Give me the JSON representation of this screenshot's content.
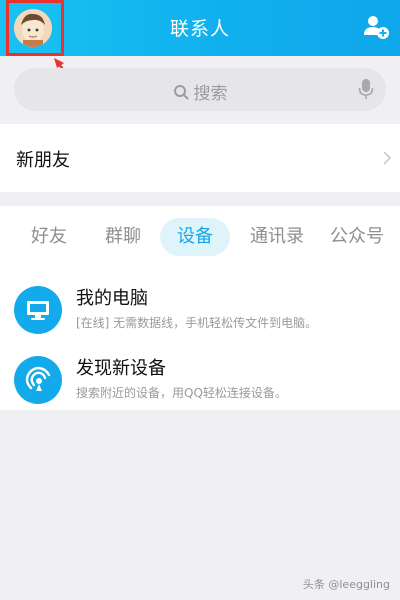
{
  "header": {
    "title": "联系人",
    "avatar_icon": "user-avatar-icon",
    "add_contact_icon": "add-contact-icon",
    "background_color": "#12b3ef"
  },
  "search": {
    "placeholder": "搜索",
    "search_icon": "search-icon",
    "mic_icon": "microphone-icon"
  },
  "new_friends": {
    "label": "新朋友",
    "chevron_icon": "chevron-right-icon"
  },
  "tabs": [
    {
      "label": "好友",
      "active": false
    },
    {
      "label": "群聊",
      "active": false
    },
    {
      "label": "设备",
      "active": true
    },
    {
      "label": "通讯录",
      "active": false
    },
    {
      "label": "公众号",
      "active": false
    }
  ],
  "devices": [
    {
      "title": "我的电脑",
      "subtitle": "[在线] 无需数据线，手机轻松传文件到电脑。",
      "icon": "computer-icon"
    },
    {
      "title": "发现新设备",
      "subtitle": "搜索附近的设备，用QQ轻松连接设备。",
      "icon": "wireless-signal-icon"
    }
  ],
  "watermark": "头条 @leeggling",
  "colors": {
    "accent": "#13a8e8",
    "annotation_red": "#e8332e"
  }
}
